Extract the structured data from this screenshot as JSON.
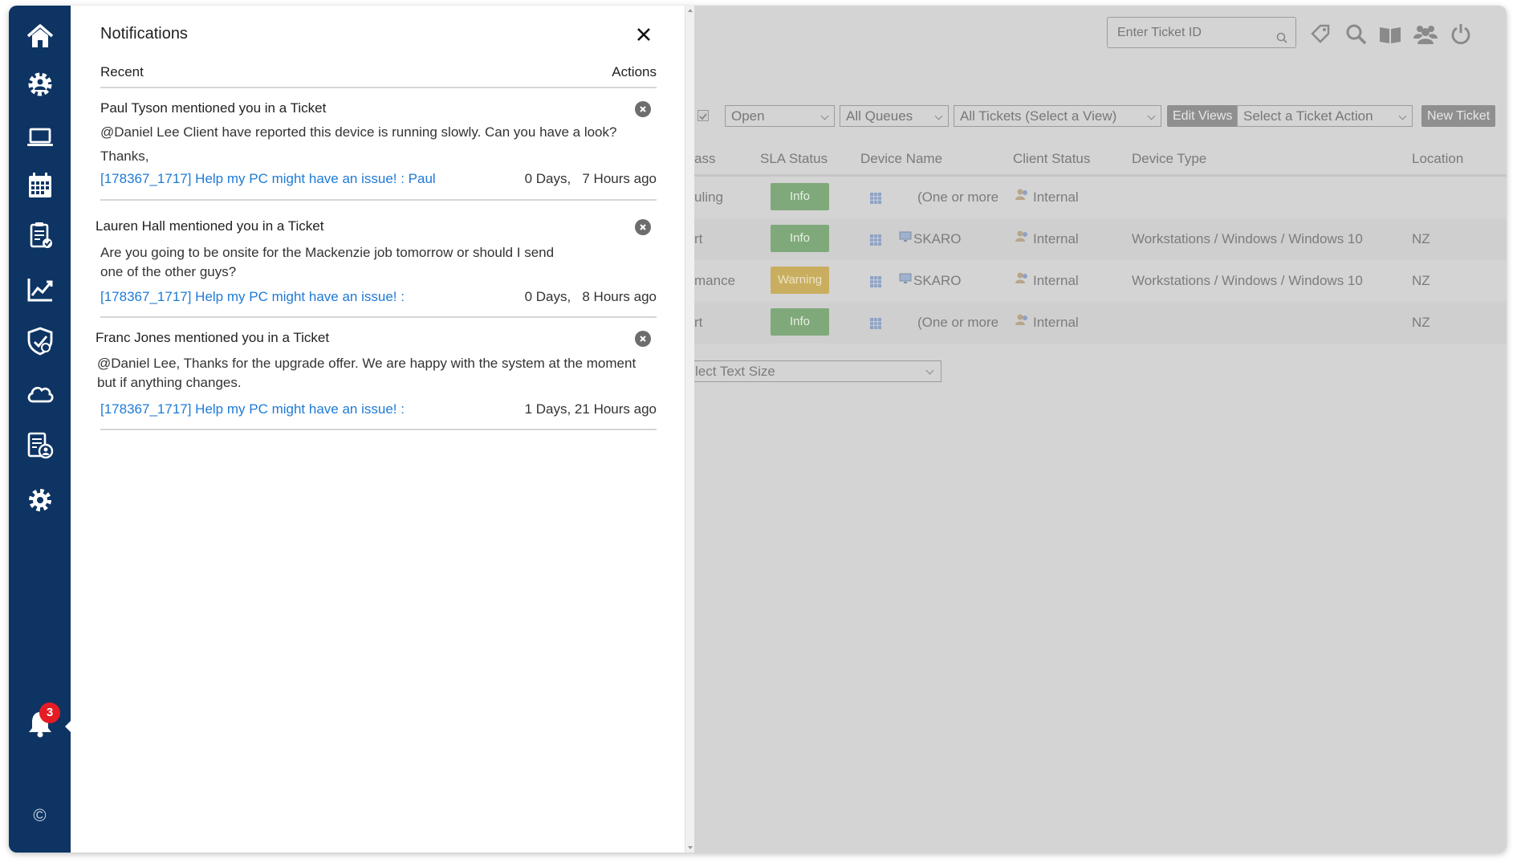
{
  "colors": {
    "sidebar": "#0d3463",
    "link": "#1e7ad6",
    "badge": "#e51c23",
    "info": "#7fa97a",
    "warning": "#c9ae5f"
  },
  "sidebar": {
    "items": [
      {
        "icon": "home-icon"
      },
      {
        "icon": "technician-gear-icon"
      },
      {
        "icon": "laptop-icon"
      },
      {
        "icon": "calendar-icon"
      },
      {
        "icon": "clipboard-check-icon"
      },
      {
        "icon": "chart-line-icon"
      },
      {
        "icon": "shield-icon"
      },
      {
        "icon": "cloud-icon"
      },
      {
        "icon": "reports-user-icon"
      },
      {
        "icon": "settings-gear-icon"
      }
    ],
    "notification_count": "3",
    "copyright": "©"
  },
  "notifications": {
    "title": "Notifications",
    "recent_label": "Recent",
    "actions_label": "Actions",
    "items": [
      {
        "who": "Paul Tyson",
        "what": "mentioned you in a Ticket",
        "body": "@Daniel Lee Client have reported this device is running slowly. Can you have a look?",
        "body2": "Thanks,",
        "link": "[178367_1717] Help my PC might have an issue! : Paul",
        "time": "0 Days,   7 Hours ago"
      },
      {
        "who": "Lauren Hall",
        "what": "mentioned you in a Ticket",
        "body": "Are you going to be onsite for the Mackenzie job tomorrow or should I send one of the other guys?",
        "link": "[178367_1717] Help my PC might have an issue! :",
        "time": "0 Days,   8 Hours ago"
      },
      {
        "who": "Franc Jones",
        "what": "mentioned you in a Ticket",
        "body": "@Daniel Lee, Thanks for the upgrade offer. We are happy with the system at the moment but if anything changes.",
        "link": "[178367_1717] Help my PC might have an issue! :",
        "time": "1 Days, 21 Hours ago"
      }
    ]
  },
  "background": {
    "ticket_id_placeholder": "Enter Ticket ID",
    "filters": {
      "status": "Open",
      "queues": "All Queues",
      "view": "All Tickets (Select a View)",
      "edit_views": "Edit Views",
      "ticket_action": "Select a Ticket Action",
      "new_ticket": "New Ticket"
    },
    "columns": [
      "ass",
      "SLA Status",
      "Device Name",
      "Client Status",
      "Device Type",
      "Location"
    ],
    "rows": [
      {
        "class": "uling",
        "sla": "Info",
        "device": "(One or more",
        "client": "Internal",
        "type": "",
        "location": "",
        "has_monitor": false
      },
      {
        "class": "rt",
        "sla": "Info",
        "device": "SKARO",
        "client": "Internal",
        "type": "Workstations / Windows / Windows 10",
        "location": "NZ",
        "has_monitor": true
      },
      {
        "class": "mance",
        "sla": "Warning",
        "device": "SKARO",
        "client": "Internal",
        "type": "Workstations / Windows / Windows 10",
        "location": "NZ",
        "has_monitor": true
      },
      {
        "class": "rt",
        "sla": "Info",
        "device": "(One or more",
        "client": "Internal",
        "type": "",
        "location": "NZ",
        "has_monitor": false
      }
    ],
    "text_size": "lect Text Size"
  }
}
